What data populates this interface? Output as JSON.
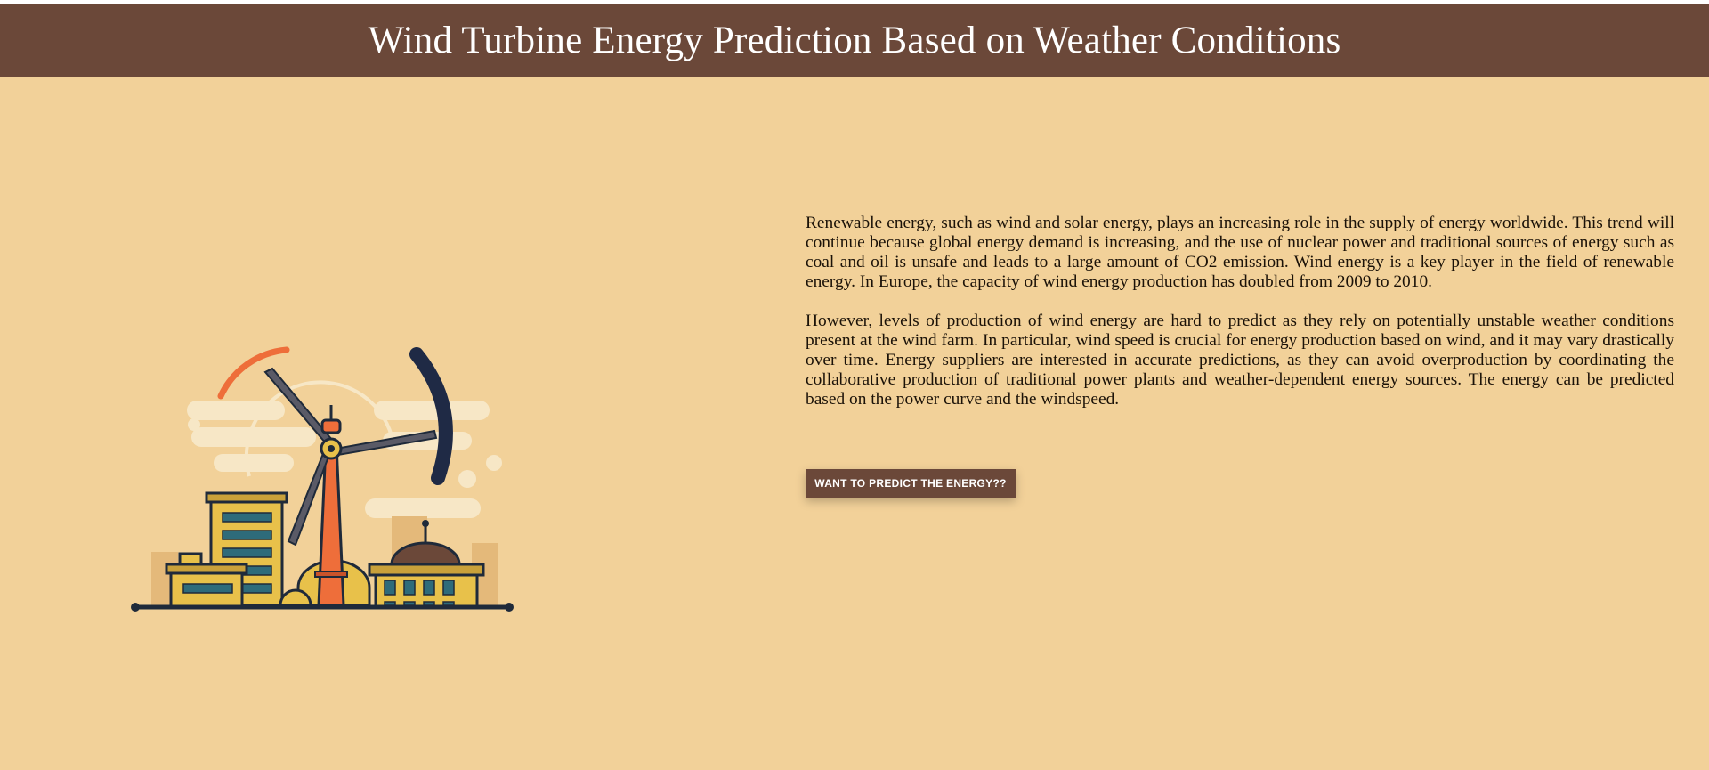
{
  "header": {
    "title": "Wind Turbine Energy Prediction Based on Weather Conditions"
  },
  "intro": {
    "paragraph1": "Renewable energy, such as wind and solar energy, plays an increasing role in the supply of energy worldwide. This trend will continue because global energy demand is increasing, and the use of nuclear power and traditional sources of energy such as coal and oil is unsafe and leads to a large amount of CO2 emission. Wind energy is a key player in the field of renewable energy. In Europe, the capacity of wind energy production has doubled from 2009 to 2010.",
    "paragraph2": "However, levels of production of wind energy are hard to predict as they rely on potentially unstable weather conditions present at the wind farm. In particular, wind speed is crucial for energy production based on wind, and it may vary drastically over time. Energy suppliers are interested in accurate predictions, as they can avoid overproduction by coordinating the collaborative production of traditional power plants and weather-dependent energy sources. The energy can be predicted based on the power curve and the windspeed."
  },
  "cta": {
    "label": "WANT TO PREDICT THE ENERGY??"
  },
  "illustration": {
    "icon": "wind-turbine-city-illustration"
  },
  "colors": {
    "background": "#f2d199",
    "header": "#6b4839",
    "button": "#6b4839",
    "turbine_tower": "#ee6e3a",
    "building": "#e8c14a",
    "window": "#2e6b7a",
    "outline": "#1f2a3a"
  }
}
